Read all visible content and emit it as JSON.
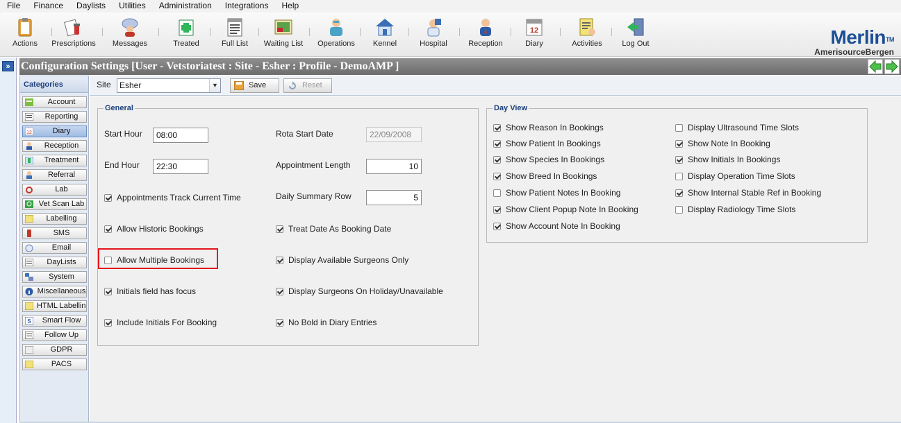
{
  "menu": [
    "File",
    "Finance",
    "Daylists",
    "Utilities",
    "Administration",
    "Integrations",
    "Help"
  ],
  "toolbar": [
    {
      "label": "Actions",
      "icon": "clipboard-icon"
    },
    {
      "label": "Prescriptions",
      "icon": "prescription-icon"
    },
    {
      "label": "Messages",
      "icon": "messages-icon"
    },
    {
      "label": "Treated",
      "icon": "treated-icon"
    },
    {
      "label": "Full List",
      "icon": "full-list-icon"
    },
    {
      "label": "Waiting List",
      "icon": "waiting-list-icon"
    },
    {
      "label": "Operations",
      "icon": "operations-icon"
    },
    {
      "label": "Kennel",
      "icon": "kennel-icon"
    },
    {
      "label": "Hospital",
      "icon": "hospital-icon"
    },
    {
      "label": "Reception",
      "icon": "reception-icon"
    },
    {
      "label": "Diary",
      "icon": "calendar-icon"
    },
    {
      "label": "Activities",
      "icon": "activities-icon"
    },
    {
      "label": "Log Out",
      "icon": "logout-icon"
    }
  ],
  "logo": {
    "brand": "Merlin",
    "tm": "TM",
    "sub": "AmerisourceBergen"
  },
  "expander": "»",
  "title": "Configuration Settings [User - Vetstoriatest : Site - Esher : Profile - DemoAMP ]",
  "categories": {
    "heading": "Categories",
    "items": [
      "Account",
      "Reporting",
      "Diary",
      "Reception",
      "Treatment",
      "Referral",
      "Lab",
      "Vet Scan Lab",
      "Labelling",
      "SMS",
      "Email",
      "DayLists",
      "System",
      "Miscellaneous",
      "HTML Labelling",
      "Smart Flow",
      "Follow Up",
      "GDPR",
      "PACS"
    ],
    "active": "Diary"
  },
  "sitebar": {
    "label": "Site",
    "value": "Esher",
    "save": "Save",
    "reset": "Reset"
  },
  "general": {
    "legend": "General",
    "start_hour_label": "Start Hour",
    "start_hour": "08:00",
    "end_hour_label": "End Hour",
    "end_hour": "22:30",
    "rota_label": "Rota Start Date",
    "rota_value": "22/09/2008",
    "appt_len_label": "Appointment Length",
    "appt_len": "10",
    "daily_summary_label": "Daily Summary Row",
    "daily_summary": "5",
    "left_checks": [
      {
        "label": "Appointments Track Current Time",
        "checked": true
      },
      {
        "label": "Allow Historic Bookings",
        "checked": true
      },
      {
        "label": "Allow Multiple Bookings",
        "checked": false
      },
      {
        "label": "Initials field has focus",
        "checked": true
      },
      {
        "label": "Include Initials For Booking",
        "checked": true
      }
    ],
    "right_checks": [
      {
        "label": "Treat Date As Booking Date",
        "checked": true
      },
      {
        "label": "Display Available Surgeons Only",
        "checked": true
      },
      {
        "label": "Display Surgeons On Holiday/Unavailable",
        "checked": true
      },
      {
        "label": "No Bold in Diary Entries",
        "checked": true
      }
    ]
  },
  "dayview": {
    "legend": "Day View",
    "col1": [
      {
        "label": "Show Reason In Bookings",
        "checked": true
      },
      {
        "label": "Show Patient In Bookings",
        "checked": true
      },
      {
        "label": "Show Species In Bookings",
        "checked": true
      },
      {
        "label": "Show Breed In Bookings",
        "checked": true
      },
      {
        "label": "Show Patient Notes In Booking",
        "checked": false
      },
      {
        "label": "Show Client Popup Note In Booking",
        "checked": true
      },
      {
        "label": "Show Account Note In Booking",
        "checked": true
      }
    ],
    "col2": [
      {
        "label": "Display Ultrasound Time Slots",
        "checked": false
      },
      {
        "label": "Show Note In Booking",
        "checked": true
      },
      {
        "label": "Show Initials In Bookings",
        "checked": true
      },
      {
        "label": "Display Operation Time Slots",
        "checked": false
      },
      {
        "label": "Show Internal Stable Ref in Booking",
        "checked": true
      },
      {
        "label": "Display Radiology Time Slots",
        "checked": false
      }
    ]
  }
}
